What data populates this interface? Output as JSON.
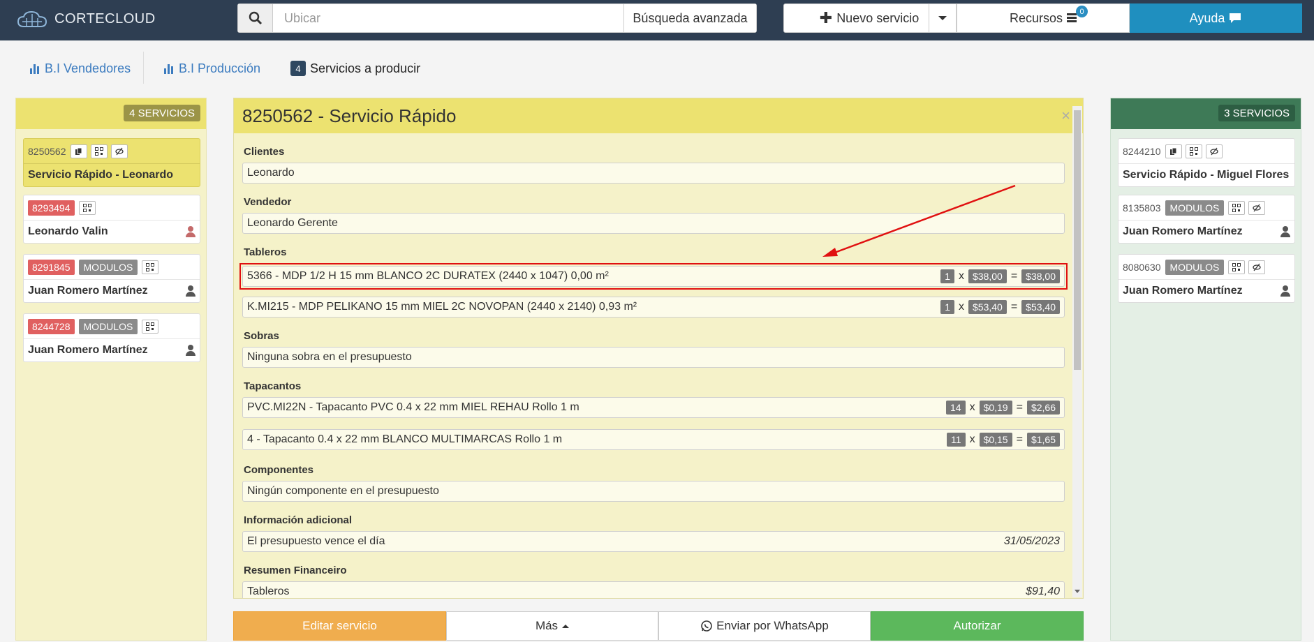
{
  "app": {
    "name": "CORTECLOUD"
  },
  "search": {
    "placeholder": "Ubicar",
    "advanced_label": "Búsqueda avanzada"
  },
  "header": {
    "new_service_label": "Nuevo servicio",
    "resources_label": "Recursos",
    "resources_badge": "0",
    "help_label": "Ayuda"
  },
  "subnav": {
    "bi_sellers": "B.I Vendedores",
    "bi_production": "B.I Producción",
    "services_count": "4",
    "services_label": "Servicios a producir"
  },
  "left_column": {
    "count_label": "4 SERVICIOS",
    "cards": [
      {
        "number": "8250562",
        "title": "Servicio Rápido - Leonardo"
      },
      {
        "number": "8293494",
        "title": "Leonardo Valin"
      },
      {
        "number": "8291845",
        "tag": "MODULOS",
        "title": "Juan Romero Martínez"
      },
      {
        "number": "8244728",
        "tag": "MODULOS",
        "title": "Juan Romero Martínez"
      }
    ]
  },
  "right_column": {
    "count_label": "3 SERVICIOS",
    "cards": [
      {
        "number": "8244210",
        "title": "Servicio Rápido - Miguel Flores"
      },
      {
        "number": "8135803",
        "tag": "MODULOS",
        "title": "Juan Romero Martínez"
      },
      {
        "number": "8080630",
        "tag": "MODULOS",
        "title": "Juan Romero Martínez"
      }
    ]
  },
  "panel": {
    "title": "8250562 - Servicio Rápido",
    "close": "×",
    "clients_label": "Clientes",
    "client_value": "Leonardo",
    "seller_label": "Vendedor",
    "seller_value": "Leonardo Gerente",
    "boards_label": "Tableros",
    "boards": [
      {
        "desc": "5366 - MDP 1/2 H 15 mm BLANCO 2C DURATEX (2440 x 1047) 0,00 m²",
        "qty": "1",
        "price": "$38,00",
        "total": "$38,00"
      },
      {
        "desc": "K.MI215 - MDP PELIKANO 15 mm MIEL 2C NOVOPAN (2440 x 2140) 0,93 m²",
        "qty": "1",
        "price": "$53,40",
        "total": "$53,40"
      }
    ],
    "leftovers_label": "Sobras",
    "leftovers_value": "Ninguna sobra en el presupuesto",
    "edgebands_label": "Tapacantos",
    "edgebands": [
      {
        "desc": "PVC.MI22N - Tapacanto PVC 0.4 x 22 mm MIEL REHAU Rollo 1 m",
        "qty": "14",
        "price": "$0,19",
        "total": "$2,66"
      },
      {
        "desc": "4 - Tapacanto 0.4 x 22 mm BLANCO MULTIMARCAS Rollo 1 m",
        "qty": "11",
        "price": "$0,15",
        "total": "$1,65"
      }
    ],
    "components_label": "Componentes",
    "components_value": "Ningún componente en el presupuesto",
    "extra_label": "Información adicional",
    "extra_text": "El presupuesto vence el día",
    "extra_date": "31/05/2023",
    "finance_label": "Resumen Financeiro",
    "finance_row_label": "Tableros",
    "finance_row_value": "$91,40"
  },
  "actions": {
    "edit": "Editar servicio",
    "more": "Más",
    "whatsapp": "Enviar por WhatsApp",
    "authorize": "Autorizar"
  },
  "colors": {
    "navbar": "#2e3e52",
    "accent_yellow": "#ece270",
    "accent_green": "#3e7a57",
    "highlight": "#e01010"
  }
}
